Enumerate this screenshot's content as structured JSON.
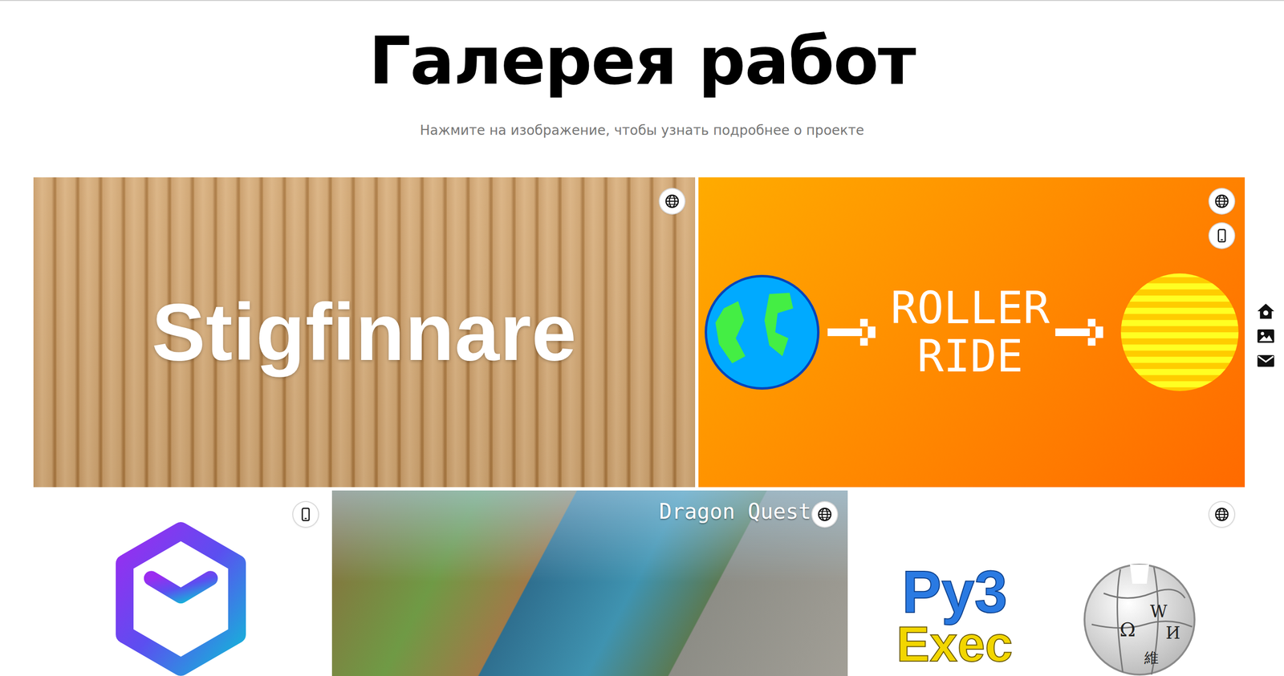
{
  "header": {
    "title": "Галерея работ",
    "subtitle": "Нажмите на изображение, чтобы узнать подробнее о проекте"
  },
  "rows": [
    {
      "cards": [
        {
          "kind": "wood",
          "label": "Stigfinnare",
          "badges": [
            {
              "kind": "web"
            }
          ]
        },
        {
          "kind": "roller",
          "lines": [
            "ROLLER",
            "RIDE"
          ],
          "badges": [
            {
              "kind": "web"
            },
            {
              "kind": "mobile"
            }
          ]
        }
      ]
    },
    {
      "cards": [
        {
          "kind": "cube",
          "badges": [
            {
              "kind": "mobile"
            }
          ]
        },
        {
          "kind": "photo",
          "label": "Dragon Quests",
          "badges": [
            {
              "kind": "web"
            }
          ]
        },
        {
          "kind": "logos",
          "label": "Py3",
          "sublabel": "Exec",
          "glyphs": [
            "Ω",
            "W",
            "И",
            "維"
          ],
          "badges": [
            {
              "kind": "web"
            }
          ]
        }
      ]
    }
  ],
  "side_nav": [
    {
      "kind": "home"
    },
    {
      "kind": "gallery"
    },
    {
      "kind": "contact"
    }
  ]
}
